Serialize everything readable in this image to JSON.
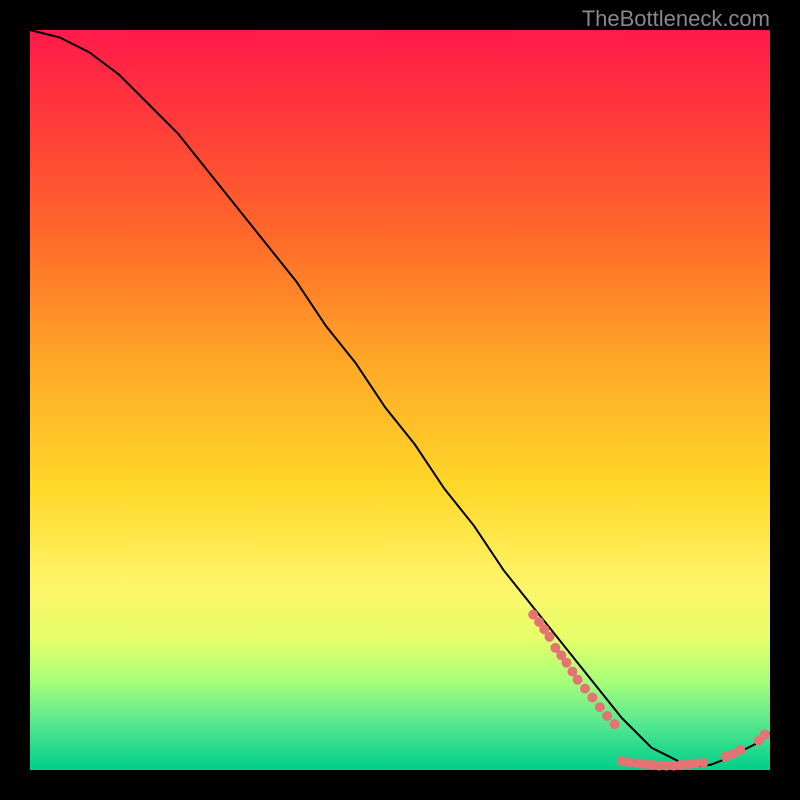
{
  "watermark": "TheBottleneck.com",
  "chart_data": {
    "type": "line",
    "title": "",
    "xlabel": "",
    "ylabel": "",
    "xlim": [
      0,
      100
    ],
    "ylim": [
      0,
      100
    ],
    "series": [
      {
        "name": "bottleneck-curve",
        "x": [
          0,
          4,
          8,
          12,
          16,
          20,
          24,
          28,
          32,
          36,
          40,
          44,
          48,
          52,
          56,
          60,
          64,
          68,
          72,
          76,
          80,
          82,
          84,
          86,
          88,
          90,
          92,
          94,
          96,
          98,
          100
        ],
        "y": [
          100,
          99,
          97,
          94,
          90,
          86,
          81,
          76,
          71,
          66,
          60,
          55,
          49,
          44,
          38,
          33,
          27,
          22,
          17,
          12,
          7,
          5,
          3,
          2,
          1,
          0.5,
          0.7,
          1.5,
          2.5,
          3.5,
          5
        ],
        "color": "#000000"
      }
    ],
    "points": {
      "name": "sample-points",
      "coords": [
        [
          68,
          21
        ],
        [
          68.8,
          20
        ],
        [
          69.5,
          19
        ],
        [
          70.2,
          18
        ],
        [
          71,
          16.5
        ],
        [
          71.8,
          15.5
        ],
        [
          72.5,
          14.5
        ],
        [
          73.3,
          13.3
        ],
        [
          74,
          12.2
        ],
        [
          75,
          11
        ],
        [
          76,
          9.8
        ],
        [
          77,
          8.5
        ],
        [
          78,
          7.3
        ],
        [
          79,
          6.2
        ],
        [
          80,
          1.2
        ],
        [
          81,
          1.0
        ],
        [
          82,
          0.9
        ],
        [
          83,
          0.8
        ],
        [
          84,
          0.7
        ],
        [
          85,
          0.6
        ],
        [
          86,
          0.6
        ],
        [
          87,
          0.6
        ],
        [
          88,
          0.7
        ],
        [
          89,
          0.8
        ],
        [
          90,
          0.9
        ],
        [
          91,
          1.0
        ],
        [
          94,
          1.8
        ],
        [
          95,
          2.2
        ],
        [
          96,
          2.7
        ],
        [
          98.5,
          4.0
        ],
        [
          99.3,
          4.8
        ]
      ],
      "color": "#e57373",
      "radius": 5
    },
    "gradient_stops": [
      {
        "pos": 0,
        "color": "#ff1a4a"
      },
      {
        "pos": 12,
        "color": "#ff3a3a"
      },
      {
        "pos": 28,
        "color": "#ff6a2a"
      },
      {
        "pos": 45,
        "color": "#ffa826"
      },
      {
        "pos": 62,
        "color": "#ffd92a"
      },
      {
        "pos": 75,
        "color": "#fff56a"
      },
      {
        "pos": 82,
        "color": "#e8ff6a"
      },
      {
        "pos": 88,
        "color": "#a8ff7a"
      },
      {
        "pos": 94,
        "color": "#52e68f"
      },
      {
        "pos": 100,
        "color": "#00cf8a"
      }
    ]
  }
}
